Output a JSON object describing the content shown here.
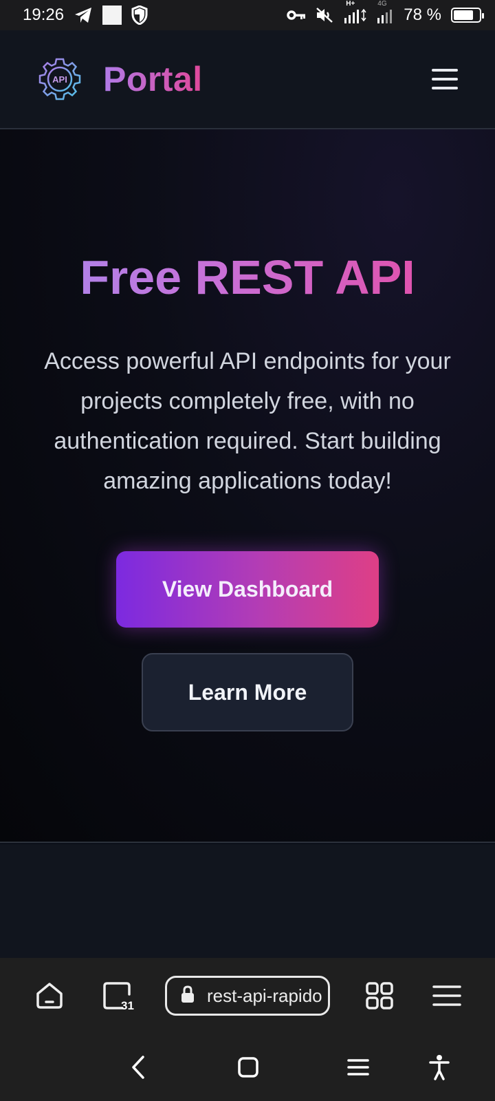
{
  "status_bar": {
    "time": "19:26",
    "battery_text": "78 %",
    "battery_level": 0.78,
    "network_labels": [
      "H+",
      "4G"
    ],
    "icons": [
      "telegram-icon",
      "white-square-notification",
      "shield-icon",
      "vpn-key-icon",
      "mute-icon",
      "signal-icon",
      "signal-icon",
      "battery-icon"
    ]
  },
  "header": {
    "logo_text": "API",
    "brand": "Portal",
    "menu_icon": "hamburger-menu-icon"
  },
  "hero": {
    "title": "Free REST API",
    "description": "Access powerful API endpoints for your projects completely free, with no authentication required. Start building amazing applications today!",
    "primary_button": "View Dashboard",
    "secondary_button": "Learn More"
  },
  "browser_toolbar": {
    "url": "rest-api-rapido",
    "tab_count": "31",
    "icons": [
      "home-icon",
      "tabs-icon",
      "lock-icon",
      "grid-icon",
      "menu-icon"
    ]
  },
  "nav_bar": {
    "icons": [
      "back-icon",
      "home-square-icon",
      "recents-icon",
      "accessibility-icon"
    ]
  },
  "colors": {
    "brand_gradient_start": "#b07be8",
    "brand_gradient_end": "#e0489a",
    "primary_button_start": "#7c2ae0",
    "primary_button_end": "#de3f86",
    "background": "#0b0f19"
  }
}
